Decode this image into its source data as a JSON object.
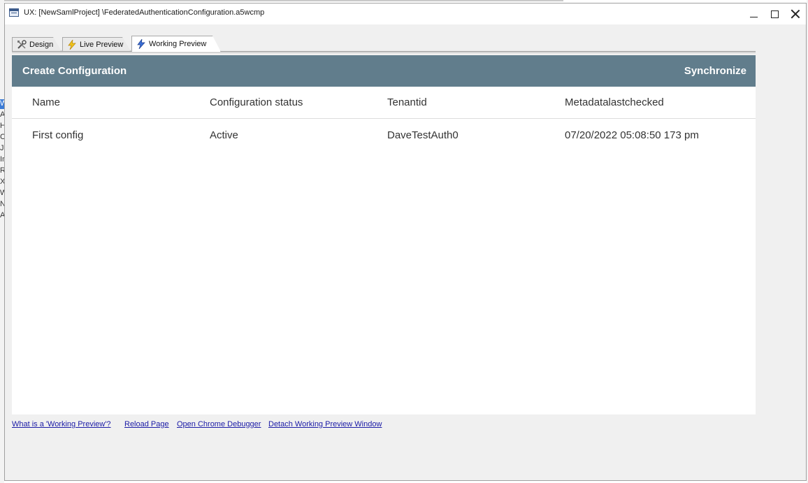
{
  "window": {
    "title": "UX: [NewSamlProject] \\FederatedAuthenticationConfiguration.a5wcmp"
  },
  "tabs": [
    {
      "label": "Design",
      "icon": "tools-icon"
    },
    {
      "label": "Live Preview",
      "icon": "lightning-yellow-icon"
    },
    {
      "label": "Working Preview",
      "icon": "lightning-blue-icon",
      "active": true
    }
  ],
  "preview": {
    "header": {
      "create_label": "Create Configuration",
      "sync_label": "Synchronize",
      "bar_color": "#617d8c"
    },
    "columns": [
      "Name",
      "Configuration status",
      "Tenantid",
      "Metadatalastchecked"
    ],
    "rows": [
      [
        "First config",
        "Active",
        "DaveTestAuth0",
        "07/20/2022 05:08:50 173 pm"
      ]
    ]
  },
  "links": {
    "what_is": "What is a 'Working Preview'?",
    "reload": "Reload Page",
    "debugger": "Open Chrome Debugger",
    "detach": "Detach Working Preview Window"
  },
  "background_strip": [
    "W",
    "A",
    "H",
    "C",
    "Ja",
    "In",
    "R",
    "X",
    "W",
    "N",
    "A"
  ]
}
